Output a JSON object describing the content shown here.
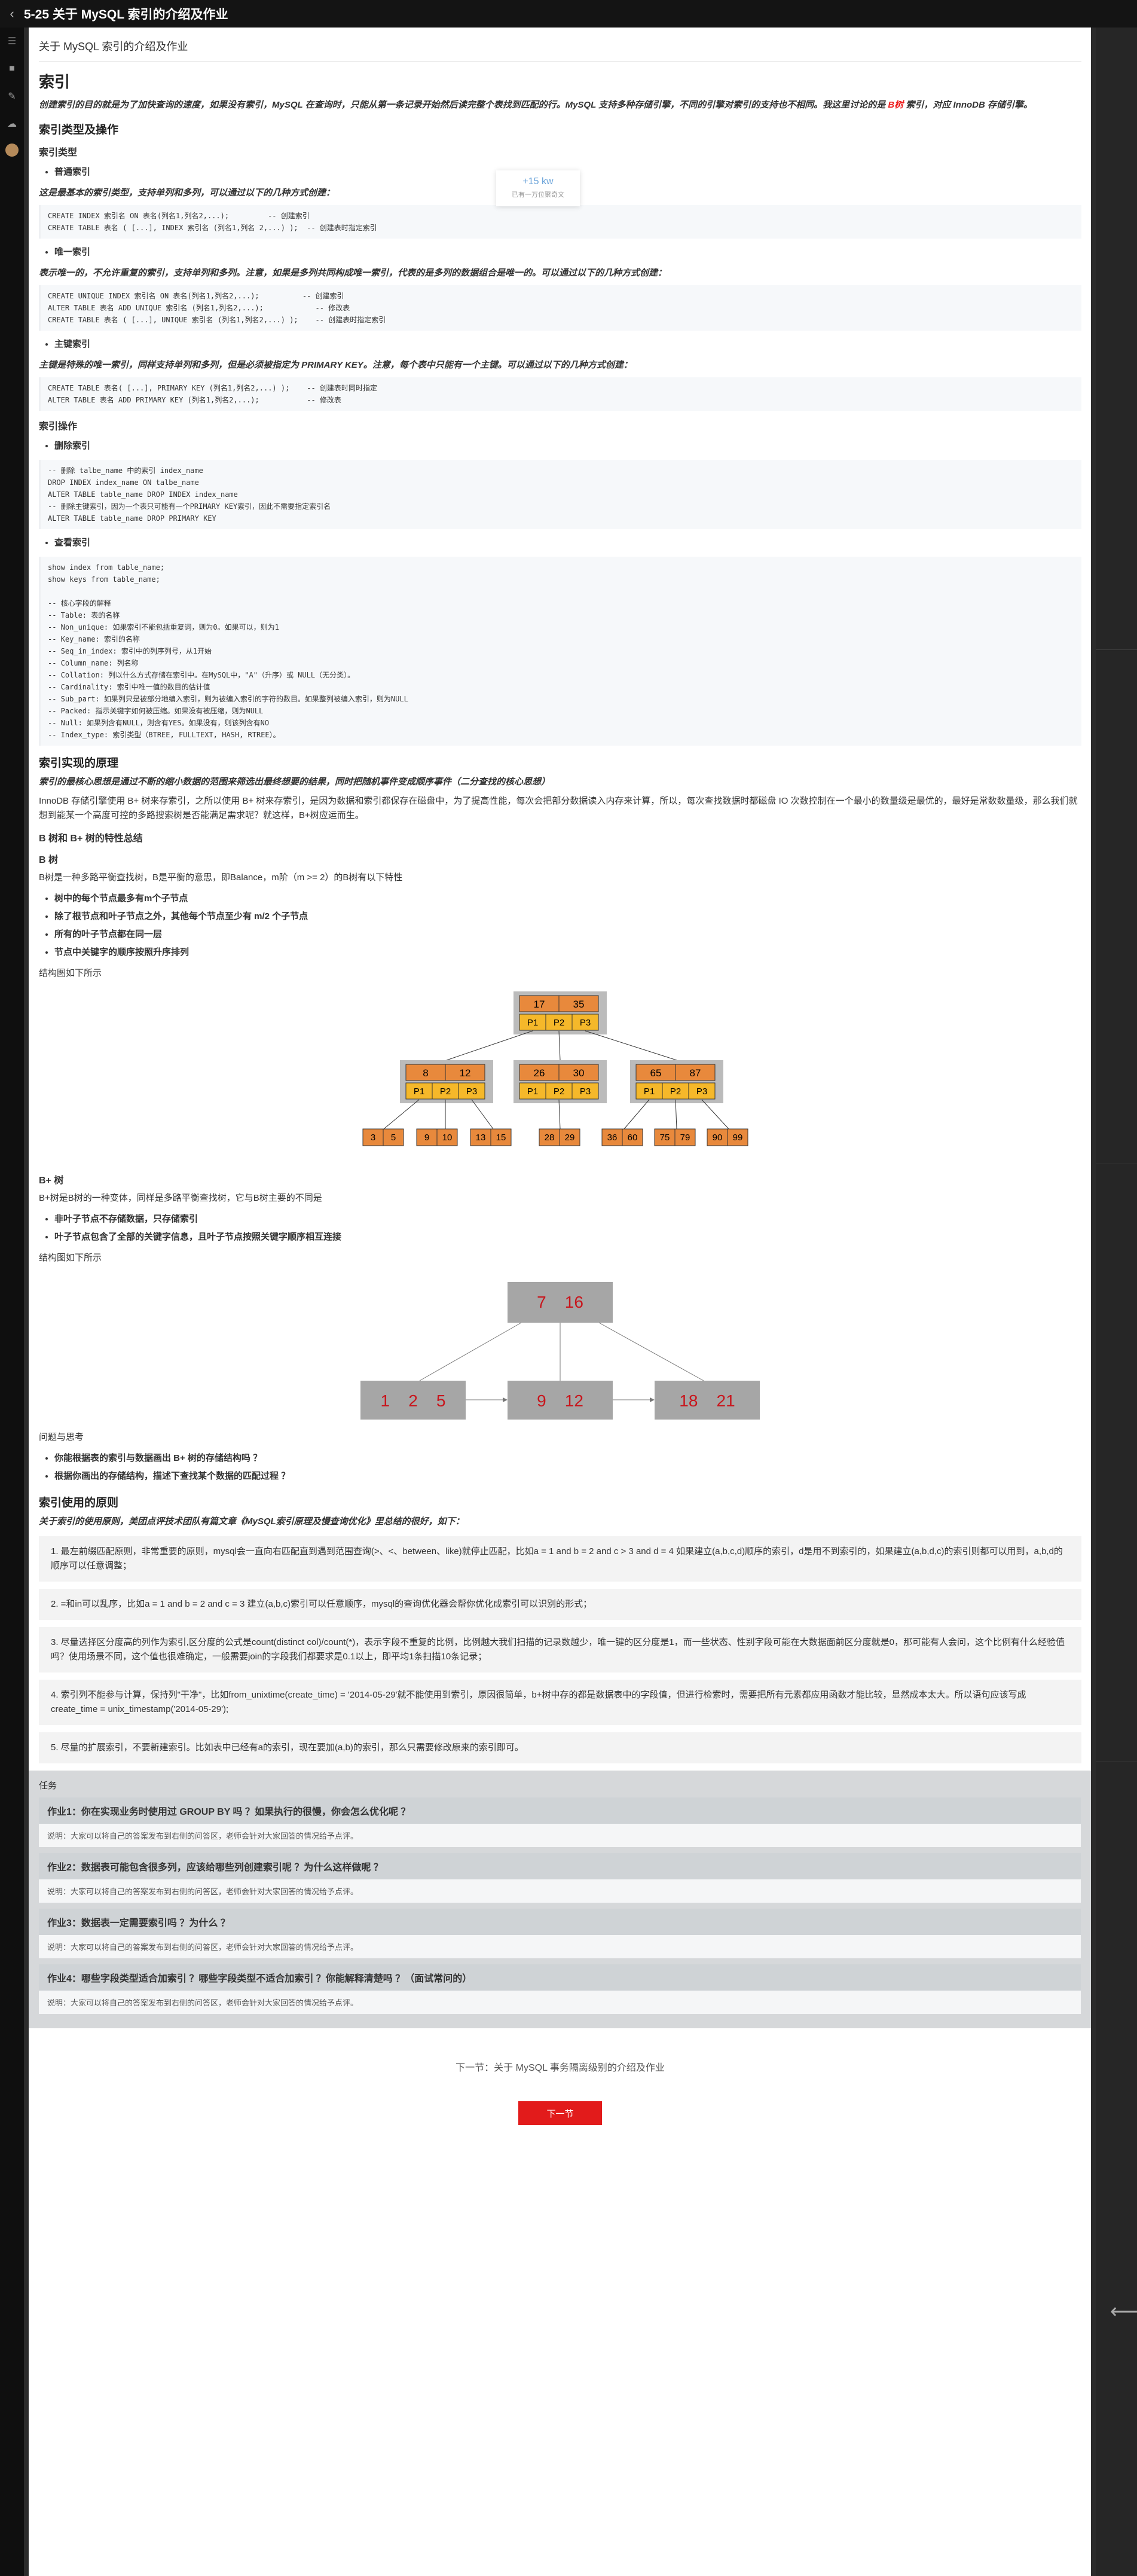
{
  "topbar": {
    "title": "5-25 关于 MySQL 索引的介绍及作业"
  },
  "breadcrumb": "关于 MySQL 索引的介绍及作业",
  "toast": {
    "count": "+15 kw",
    "hint": "已有一万位聚奇文"
  },
  "article": {
    "title": "索引",
    "intro_a": "创建索引的目的就是为了加快查询的速度，如果没有索引，MySQL 在查询时，只能从第一条记录开始然后读完整个表找到匹配的行。MySQL 支持多种存储引擎，不同的引擎对索引的支持也不相同。我这里讨论的是 ",
    "intro_red": "B树",
    "intro_b": " 索引，对应 InnoDB 存储引擎。",
    "h_types": "索引类型及操作",
    "h_type_sub": "索引类型",
    "li_normal": "普通索引",
    "p_normal": "这是最基本的索引类型，支持单列和多列，可以通过以下的几种方式创建：",
    "code_normal": "CREATE INDEX 索引名 ON 表名(列名1,列名2,...);         -- 创建索引\nCREATE TABLE 表名 ( [...], INDEX 索引名 (列名1,列名 2,...) );  -- 创建表时指定索引",
    "li_unique": "唯一索引",
    "p_unique": "表示唯一的，不允许重复的索引，支持单列和多列。注意，如果是多列共同构成唯一索引，代表的是多列的数据组合是唯一的。可以通过以下的几种方式创建：",
    "code_unique": "CREATE UNIQUE INDEX 索引名 ON 表名(列名1,列名2,...);          -- 创建索引\nALTER TABLE 表名 ADD UNIQUE 索引名 (列名1,列名2,...);            -- 修改表\nCREATE TABLE 表名 ( [...], UNIQUE 索引名 (列名1,列名2,...) );    -- 创建表时指定索引",
    "li_primary": "主键索引",
    "p_primary": "主键是特殊的唯一索引，同样支持单列和多列，但是必须被指定为 PRIMARY KEY。注意，每个表中只能有一个主键。可以通过以下的几种方式创建：",
    "code_primary": "CREATE TABLE 表名( [...], PRIMARY KEY (列名1,列名2,...) );    -- 创建表时同时指定\nALTER TABLE 表名 ADD PRIMARY KEY (列名1,列名2,...);           -- 修改表",
    "h_ops": "索引操作",
    "li_drop": "删除索引",
    "code_drop": "-- 删除 talbe_name 中的索引 index_name\nDROP INDEX index_name ON talbe_name\nALTER TABLE table_name DROP INDEX index_name\n-- 删除主键索引，因为一个表只可能有一个PRIMARY KEY索引，因此不需要指定索引名\nALTER TABLE table_name DROP PRIMARY KEY",
    "li_show": "查看索引",
    "code_show": "show index from table_name;\nshow keys from table_name;\n\n-- 核心字段的解释\n-- Table: 表的名称\n-- Non_unique: 如果索引不能包括重复词，则为0。如果可以，则为1\n-- Key_name: 索引的名称\n-- Seq_in_index: 索引中的列序列号，从1开始\n-- Column_name: 列名称\n-- Collation: 列以什么方式存储在索引中。在MySQL中，\"A\"（升序）或 NULL（无分类）。\n-- Cardinality: 索引中唯一值的数目的估计值\n-- Sub_part: 如果列只是被部分地编入索引，则为被编入索引的字符的数目。如果整列被编入索引，则为NULL\n-- Packed: 指示关键字如何被压缩。如果没有被压缩，则为NULL\n-- Null: 如果列含有NULL，则含有YES。如果没有，则该列含有NO\n-- Index_type: 索引类型（BTREE, FULLTEXT, HASH, RTREE）。",
    "h_principle": "索引实现的原理",
    "p_principle_it": "索引的最核心思想是通过不断的缩小数据的范围来筛选出最终想要的结果，同时把随机事件变成顺序事件（二分查找的核心思想）",
    "p_principle": "InnoDB 存储引擎使用 B+ 树来存索引，之所以使用 B+ 树来存索引，是因为数据和索引都保存在磁盘中，为了提高性能，每次会把部分数据读入内存来计算，所以，每次查找数据时都磁盘 IO 次数控制在一个最小的数量级是最优的，最好是常数数量级，那么我们就想到能某一个高度可控的多路搜索树是否能满足需求呢？就这样，B+树应运而生。",
    "h_btree_summary": "B 树和 B+ 树的特性总结",
    "h_btree": "B 树",
    "p_btree": "B树是一种多路平衡查找树，B是平衡的意思，即Balance，m阶（m >= 2）的B树有以下特性",
    "btree_items": [
      "树中的每个节点最多有m个子节点",
      "除了根节点和叶子节点之外，其他每个节点至少有 m/2 个子节点",
      "所有的叶子节点都在同一层",
      "节点中关键字的顺序按照升序排列"
    ],
    "p_struct1": "结构图如下所示",
    "btree_diagram": {
      "root": [
        "17",
        "35"
      ],
      "ptr": [
        "P1",
        "P2",
        "P3"
      ],
      "mid": [
        [
          "8",
          "12"
        ],
        [
          "26",
          "30"
        ],
        [
          "65",
          "87"
        ]
      ],
      "leaves": [
        [
          "3",
          "5"
        ],
        [
          "9",
          "10"
        ],
        [
          "13",
          "15"
        ],
        [
          "28",
          "29"
        ],
        [
          "36",
          "60"
        ],
        [
          "75",
          "79"
        ],
        [
          "90",
          "99"
        ]
      ]
    },
    "h_bplus": "B+ 树",
    "p_bplus": "B+树是B树的一种变体，同样是多路平衡查找树，它与B树主要的不同是",
    "bplus_items": [
      "非叶子节点不存储数据，只存储索引",
      "叶子节点包含了全部的关键字信息，且叶子节点按照关键字顺序相互连接"
    ],
    "p_struct2": "结构图如下所示",
    "bplus_diagram": {
      "root": "7    16",
      "leaves": [
        "1    2    5",
        "9    12",
        "18    21"
      ]
    },
    "h_question": "问题与思考",
    "question_items": [
      "你能根据表的索引与数据画出 B+ 树的存储结构吗 ？",
      "根据你画出的存储结构，描述下查找某个数据的匹配过程 ？"
    ],
    "h_usage": "索引使用的原则",
    "p_usage_it": "关于索引的使用原则，美团点评技术团队有篇文章《MySQL索引原理及慢查询优化》里总结的很好，如下：",
    "tips": [
      "1. 最左前缀匹配原则，非常重要的原则，mysql会一直向右匹配直到遇到范围查询(>、<、between、like)就停止匹配，比如a = 1 and b = 2 and c > 3 and d = 4 如果建立(a,b,c,d)顺序的索引，d是用不到索引的，如果建立(a,b,d,c)的索引则都可以用到，a,b,d的顺序可以任意调整；",
      "2. =和in可以乱序，比如a = 1 and b = 2 and c = 3 建立(a,b,c)索引可以任意顺序，mysql的查询优化器会帮你优化成索引可以识别的形式；",
      "3. 尽量选择区分度高的列作为索引,区分度的公式是count(distinct col)/count(*)，表示字段不重复的比例，比例越大我们扫描的记录数越少，唯一键的区分度是1，而一些状态、性别字段可能在大数据面前区分度就是0，那可能有人会问，这个比例有什么经验值吗？使用场景不同，这个值也很难确定，一般需要join的字段我们都要求是0.1以上，即平均1条扫描10条记录；",
      "4. 索引列不能参与计算，保持列\"干净\"，比如from_unixtime(create_time) = '2014-05-29'就不能使用到索引，原因很简单，b+树中存的都是数据表中的字段值，但进行检索时，需要把所有元素都应用函数才能比较，显然成本太大。所以语句应该写成create_time = unix_timestamp('2014-05-29');",
      "5. 尽量的扩展索引，不要新建索引。比如表中已经有a的索引，现在要加(a,b)的索引，那么只需要修改原来的索引即可。"
    ]
  },
  "tasks": {
    "label": "任务",
    "items": [
      {
        "title": "作业1：你在实现业务时使用过 GROUP BY 吗 ？如果执行的很慢，你会怎么优化呢 ？",
        "note": "说明：大家可以将自己的答案发布到右侧的问答区，老师会针对大家回答的情况给予点评。"
      },
      {
        "title": "作业2：数据表可能包含很多列，应该给哪些列创建索引呢 ？为什么这样做呢 ？",
        "note": "说明：大家可以将自己的答案发布到右侧的问答区，老师会针对大家回答的情况给予点评。"
      },
      {
        "title": "作业3：数据表一定需要索引吗 ？为什么 ？",
        "note": "说明：大家可以将自己的答案发布到右侧的问答区，老师会针对大家回答的情况给予点评。"
      },
      {
        "title": "作业4：哪些字段类型适合加索引 ？哪些字段类型不适合加索引 ？你能解释清楚吗 ？（面试常问的）",
        "note": "说明：大家可以将自己的答案发布到右侧的问答区，老师会针对大家回答的情况给予点评。"
      }
    ]
  },
  "footer": {
    "next_link": "下一节：关于 MySQL 事务隔离级别的介绍及作业",
    "next_button": "下一节"
  },
  "colors": {
    "node_orange": "#e8893c",
    "node_yellow": "#f5b82a",
    "node_gray": "#a6a6a6",
    "key_red": "#c8161d",
    "next_button": "#e21b1b"
  }
}
